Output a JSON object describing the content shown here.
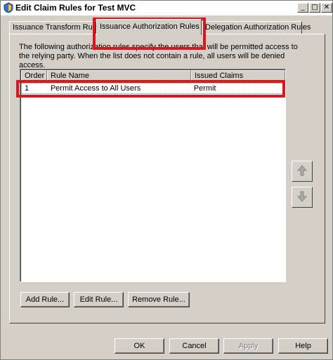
{
  "window": {
    "title": "Edit Claim Rules for Test MVC",
    "controls": {
      "minimize": "_",
      "maximize": "□",
      "close": "✕"
    }
  },
  "tabs": [
    {
      "label": "Issuance Transform Rules",
      "selected": false
    },
    {
      "label": "Issuance Authorization Rules",
      "selected": true
    },
    {
      "label": "Delegation Authorization Rules",
      "selected": false
    }
  ],
  "description": "The following authorization rules specify the users that will be permitted access to the relying party. When the list does not contain a rule, all users will be denied access.",
  "rules_table": {
    "columns": [
      "Order",
      "Rule Name",
      "Issued Claims"
    ],
    "rows": [
      {
        "order": "1",
        "name": "Permit Access to All Users",
        "claims": "Permit"
      }
    ]
  },
  "reorder": {
    "up_icon": "arrow-up-icon",
    "down_icon": "arrow-down-icon"
  },
  "rule_buttons": {
    "add": "Add Rule...",
    "edit": "Edit Rule...",
    "remove": "Remove Rule..."
  },
  "dialog_buttons": {
    "ok": "OK",
    "cancel": "Cancel",
    "apply": "Apply",
    "help": "Help"
  },
  "colors": {
    "dialog_bg": "#d4d0c8",
    "highlight": "#d9171f",
    "disabled_text": "#808080"
  }
}
